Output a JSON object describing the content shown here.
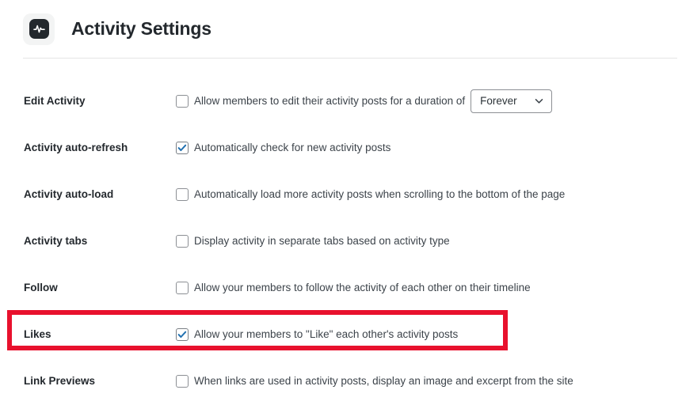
{
  "header": {
    "title": "Activity Settings",
    "icon": "activity-pulse-icon"
  },
  "colors": {
    "title_text": "#23282d",
    "body_text": "#3c434a",
    "divider": "#e5e5e5",
    "checkbox_border": "#8c8f94",
    "checkbox_check": "#2271b1",
    "icon_badge_bg": "#23282d",
    "highlight_outline": "#e8112d"
  },
  "settings": [
    {
      "label": "Edit Activity",
      "checkbox_name": "edit-activity-checkbox",
      "checked": false,
      "description": "Allow members to edit their activity posts for a duration of",
      "control": {
        "type": "select",
        "name": "edit-activity-duration-select",
        "value": "Forever"
      }
    },
    {
      "label": "Activity auto-refresh",
      "checkbox_name": "activity-auto-refresh-checkbox",
      "checked": true,
      "description": "Automatically check for new activity posts",
      "control": null
    },
    {
      "label": "Activity auto-load",
      "checkbox_name": "activity-auto-load-checkbox",
      "checked": false,
      "description": "Automatically load more activity posts when scrolling to the bottom of the page",
      "control": null
    },
    {
      "label": "Activity tabs",
      "checkbox_name": "activity-tabs-checkbox",
      "checked": false,
      "description": "Display activity in separate tabs based on activity type",
      "control": null
    },
    {
      "label": "Follow",
      "checkbox_name": "follow-checkbox",
      "checked": false,
      "description": "Allow your members to follow the activity of each other on their timeline",
      "control": null
    },
    {
      "label": "Likes",
      "checkbox_name": "likes-checkbox",
      "checked": true,
      "description": "Allow your members to \"Like\" each other's activity posts",
      "control": null,
      "highlighted": true
    },
    {
      "label": "Link Previews",
      "checkbox_name": "link-previews-checkbox",
      "checked": false,
      "description": "When links are used in activity posts, display an image and excerpt from the site",
      "control": null
    }
  ]
}
